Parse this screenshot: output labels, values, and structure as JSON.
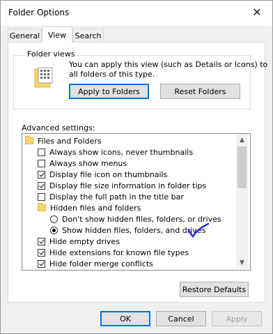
{
  "window": {
    "title": "Folder Options",
    "close_glyph": "✕"
  },
  "tabs": [
    {
      "label": "General"
    },
    {
      "label": "View",
      "active": true
    },
    {
      "label": "Search"
    }
  ],
  "folder_views": {
    "group_label": "Folder views",
    "description_line1": "You can apply this view (such as Details or Icons) to",
    "description_line2": "all folders of this type.",
    "apply_button": "Apply to Folders",
    "reset_button": "Reset Folders"
  },
  "advanced": {
    "label": "Advanced settings:",
    "items": [
      {
        "type": "folder",
        "label": "Files and Folders"
      },
      {
        "type": "checkbox",
        "checked": false,
        "label": "Always show icons, never thumbnails"
      },
      {
        "type": "checkbox",
        "checked": false,
        "label": "Always show menus"
      },
      {
        "type": "checkbox",
        "checked": true,
        "label": "Display file icon on thumbnails"
      },
      {
        "type": "checkbox",
        "checked": true,
        "label": "Display file size information in folder tips"
      },
      {
        "type": "checkbox",
        "checked": false,
        "label": "Display the full path in the title bar"
      },
      {
        "type": "folder",
        "label": "Hidden files and folders"
      },
      {
        "type": "radio",
        "checked": false,
        "label": "Don't show hidden files, folders, or drives"
      },
      {
        "type": "radio",
        "checked": true,
        "label": "Show hidden files, folders, and drives"
      },
      {
        "type": "checkbox",
        "checked": true,
        "label": "Hide empty drives"
      },
      {
        "type": "checkbox",
        "checked": true,
        "label": "Hide extensions for known file types"
      },
      {
        "type": "checkbox",
        "checked": true,
        "label": "Hide folder merge conflicts"
      }
    ]
  },
  "buttons": {
    "restore_defaults": "Restore Defaults",
    "ok": "OK",
    "cancel": "Cancel",
    "apply": "Apply"
  },
  "colors": {
    "annotation_checkmark": "#1b2fd6",
    "focus_border": "#0078d7"
  }
}
